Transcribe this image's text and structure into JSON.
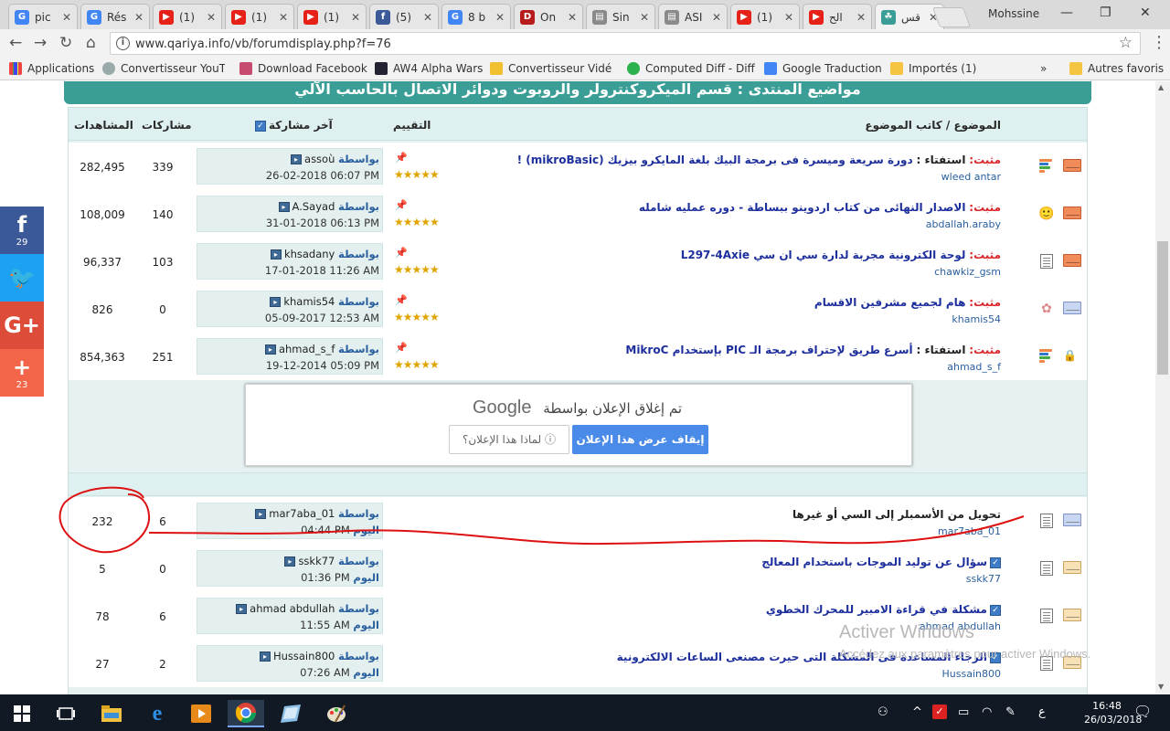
{
  "browser": {
    "tabs": [
      {
        "title": "pic",
        "icon": "google-icon",
        "color": "#4285f4"
      },
      {
        "title": "Rés",
        "icon": "google-icon",
        "color": "#4285f4"
      },
      {
        "title": "(1)",
        "icon": "youtube-icon",
        "color": "#e62117"
      },
      {
        "title": "(1)",
        "icon": "youtube-icon",
        "color": "#e62117"
      },
      {
        "title": "(1)",
        "icon": "youtube-icon",
        "color": "#e62117"
      },
      {
        "title": "(5)",
        "icon": "facebook-icon",
        "color": "#3b5998"
      },
      {
        "title": "8 b",
        "icon": "google-icon",
        "color": "#4285f4"
      },
      {
        "title": "On",
        "icon": "d-icon",
        "color": "#b71c1c"
      },
      {
        "title": "Sin",
        "icon": "document-icon",
        "color": "#8a8a8a"
      },
      {
        "title": "ASI",
        "icon": "document-icon",
        "color": "#8a8a8a"
      },
      {
        "title": "(1)",
        "icon": "youtube-icon",
        "color": "#e62117"
      },
      {
        "title": "الح",
        "icon": "youtube-icon",
        "color": "#e62117"
      },
      {
        "title": "قس",
        "icon": "qariya-icon",
        "color": "#3a9e96"
      }
    ],
    "user": "Mohssine",
    "url": "www.qariya.info/vb/forumdisplay.php?f=76",
    "bookmarks": [
      "Applications",
      "Convertisseur YouTub",
      "Download Facebook",
      "AW4 Alpha Wars",
      "Convertisseur Vidéo",
      "Computed Diff - Diff",
      "Google Traduction",
      "Importés (1)",
      "»",
      "Autres favoris"
    ]
  },
  "forum": {
    "header_title": "مواضيع المنتدى : قسم الميكروكنترولر والروبوت ودوائر الاتصال بالحاسب الآلي",
    "columns": {
      "views": "المشاهدات",
      "replies": "مشاركات",
      "last_post": "آخر مشاركة",
      "rating": "التقييم",
      "thread": "الموضوع / كاتب الموضوع"
    },
    "by_label": "بواسطة",
    "sticky_label": "مثبت:",
    "sticky_threads": [
      {
        "prefix": "استفتاء :",
        "title": "دورة سريعة وميسرة فى برمجة البيك بلغة المايكرو بيزيك (mikroBasic) !",
        "author": "wleed antar",
        "views": "282,495",
        "replies": "339",
        "last_user": "assoù",
        "last_time": "26-02-2018 06:07 PM"
      },
      {
        "prefix": "",
        "title": "الاصدار النهائى من كتاب اردوينو ببساطة - دوره عمليه شامله",
        "author": "abdallah.araby",
        "views": "108,009",
        "replies": "140",
        "last_user": "A.Sayad",
        "last_time": "31-01-2018 06:13 PM"
      },
      {
        "prefix": "",
        "title": "لوحة الكترونية مجربة لدارة سي ان سي L297-4Axie",
        "author": "chawkiz_gsm",
        "views": "96,337",
        "replies": "103",
        "last_user": "khsadany",
        "last_time": "17-01-2018 11:26 AM"
      },
      {
        "prefix": "",
        "title": "هام لجميع مشرفين الاقسام",
        "author": "khamis54",
        "views": "826",
        "replies": "0",
        "last_user": "khamis54",
        "last_time": "05-09-2017 12:53 AM"
      },
      {
        "prefix": "استفتاء :",
        "title": "أسرع طريق لإحتراف برمجة الـ PIC بإستخدام MikroC",
        "author": "ahmad_s_f",
        "views": "854,363",
        "replies": "251",
        "last_user": "ahmad_s_f",
        "last_time": "19-12-2014 05:09 PM"
      }
    ],
    "ad": {
      "closed_text": "تم إغلاق الإعلان بواسطة",
      "brand": "Google",
      "stop_button": "إيقاف عرض هذا الإعلان",
      "why_button": "لماذا هذا الإعلان؟"
    },
    "today_label": "اليوم",
    "threads": [
      {
        "title": "تحويل من الأسمبلر إلى السي أو غيرها",
        "author": "mar7aba_01",
        "views": "232",
        "replies": "6",
        "last_user": "mar7aba_01",
        "last_time": "04:44 PM"
      },
      {
        "title": "سؤال عن توليد الموجات باستخدام المعالج",
        "author": "sskk77",
        "views": "5",
        "replies": "0",
        "last_user": "sskk77",
        "last_time": "01:36 PM"
      },
      {
        "title": "مشكلة في قراءة الامبير للمحرك الخطوي",
        "author": "ahmad abdullah",
        "views": "78",
        "replies": "6",
        "last_user": "ahmad abdullah",
        "last_time": "11:55 AM"
      },
      {
        "title": "الرجاء المساعدة فى المشكلة التى حيرت مصنعى الساعات الالكترونية",
        "author": "Hussain800",
        "views": "27",
        "replies": "2",
        "last_user": "Hussain800",
        "last_time": "07:26 AM"
      }
    ]
  },
  "social": [
    {
      "icon": "facebook-icon",
      "glyph": "f",
      "count": "29",
      "color": "#3b5998"
    },
    {
      "icon": "twitter-icon",
      "glyph": "🐦",
      "count": "",
      "color": "#1da1f2"
    },
    {
      "icon": "google-plus-icon",
      "glyph": "G+",
      "count": "",
      "color": "#dd4b39"
    },
    {
      "icon": "share-plus-icon",
      "glyph": "+",
      "count": "23",
      "color": "#f26548"
    }
  ],
  "watermark": {
    "line1": "Activer Windows",
    "line2": "Accédez aux paramètres pour activer Windows."
  },
  "taskbar": {
    "time": "16:48",
    "date": "26/03/2018",
    "lang": "ع"
  }
}
